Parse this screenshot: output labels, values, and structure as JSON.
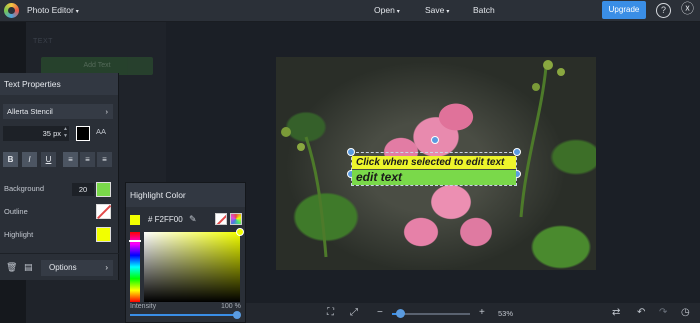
{
  "header": {
    "app_title": "Photo Editor",
    "menu": [
      "Open",
      "Save",
      "Batch"
    ],
    "upgrade_label": "Upgrade",
    "help_icon": "?",
    "fx_icon": "ⓧ"
  },
  "sidebar_bg": {
    "faded_label": "TEXT",
    "faded_button": "Add Text"
  },
  "canvas": {
    "line1": "Click when selected to edit text",
    "line2": "edit text",
    "line1_bg": "#eef52b",
    "line2_bg": "#7ad94a"
  },
  "text_properties": {
    "title": "Text Properties",
    "font": "Allerta Stencil",
    "size": "35 px",
    "aa_label": "AA",
    "format_buttons": [
      "B",
      "I",
      "U",
      "≡",
      "≡",
      "≡"
    ],
    "background_label": "Background",
    "background_value": "20",
    "background_color": "#7ad94a",
    "outline_label": "Outline",
    "highlight_label": "Highlight",
    "highlight_color": "#f2ff00",
    "options_label": "Options"
  },
  "highlight_color": {
    "title": "Highlight Color",
    "hex": "# F2FF00",
    "intensity_label": "Intensity",
    "intensity_value": "100 %",
    "intensity_level": 1.0
  },
  "bottom": {
    "zoom_value": "53%",
    "zoom_level": 0.1
  }
}
